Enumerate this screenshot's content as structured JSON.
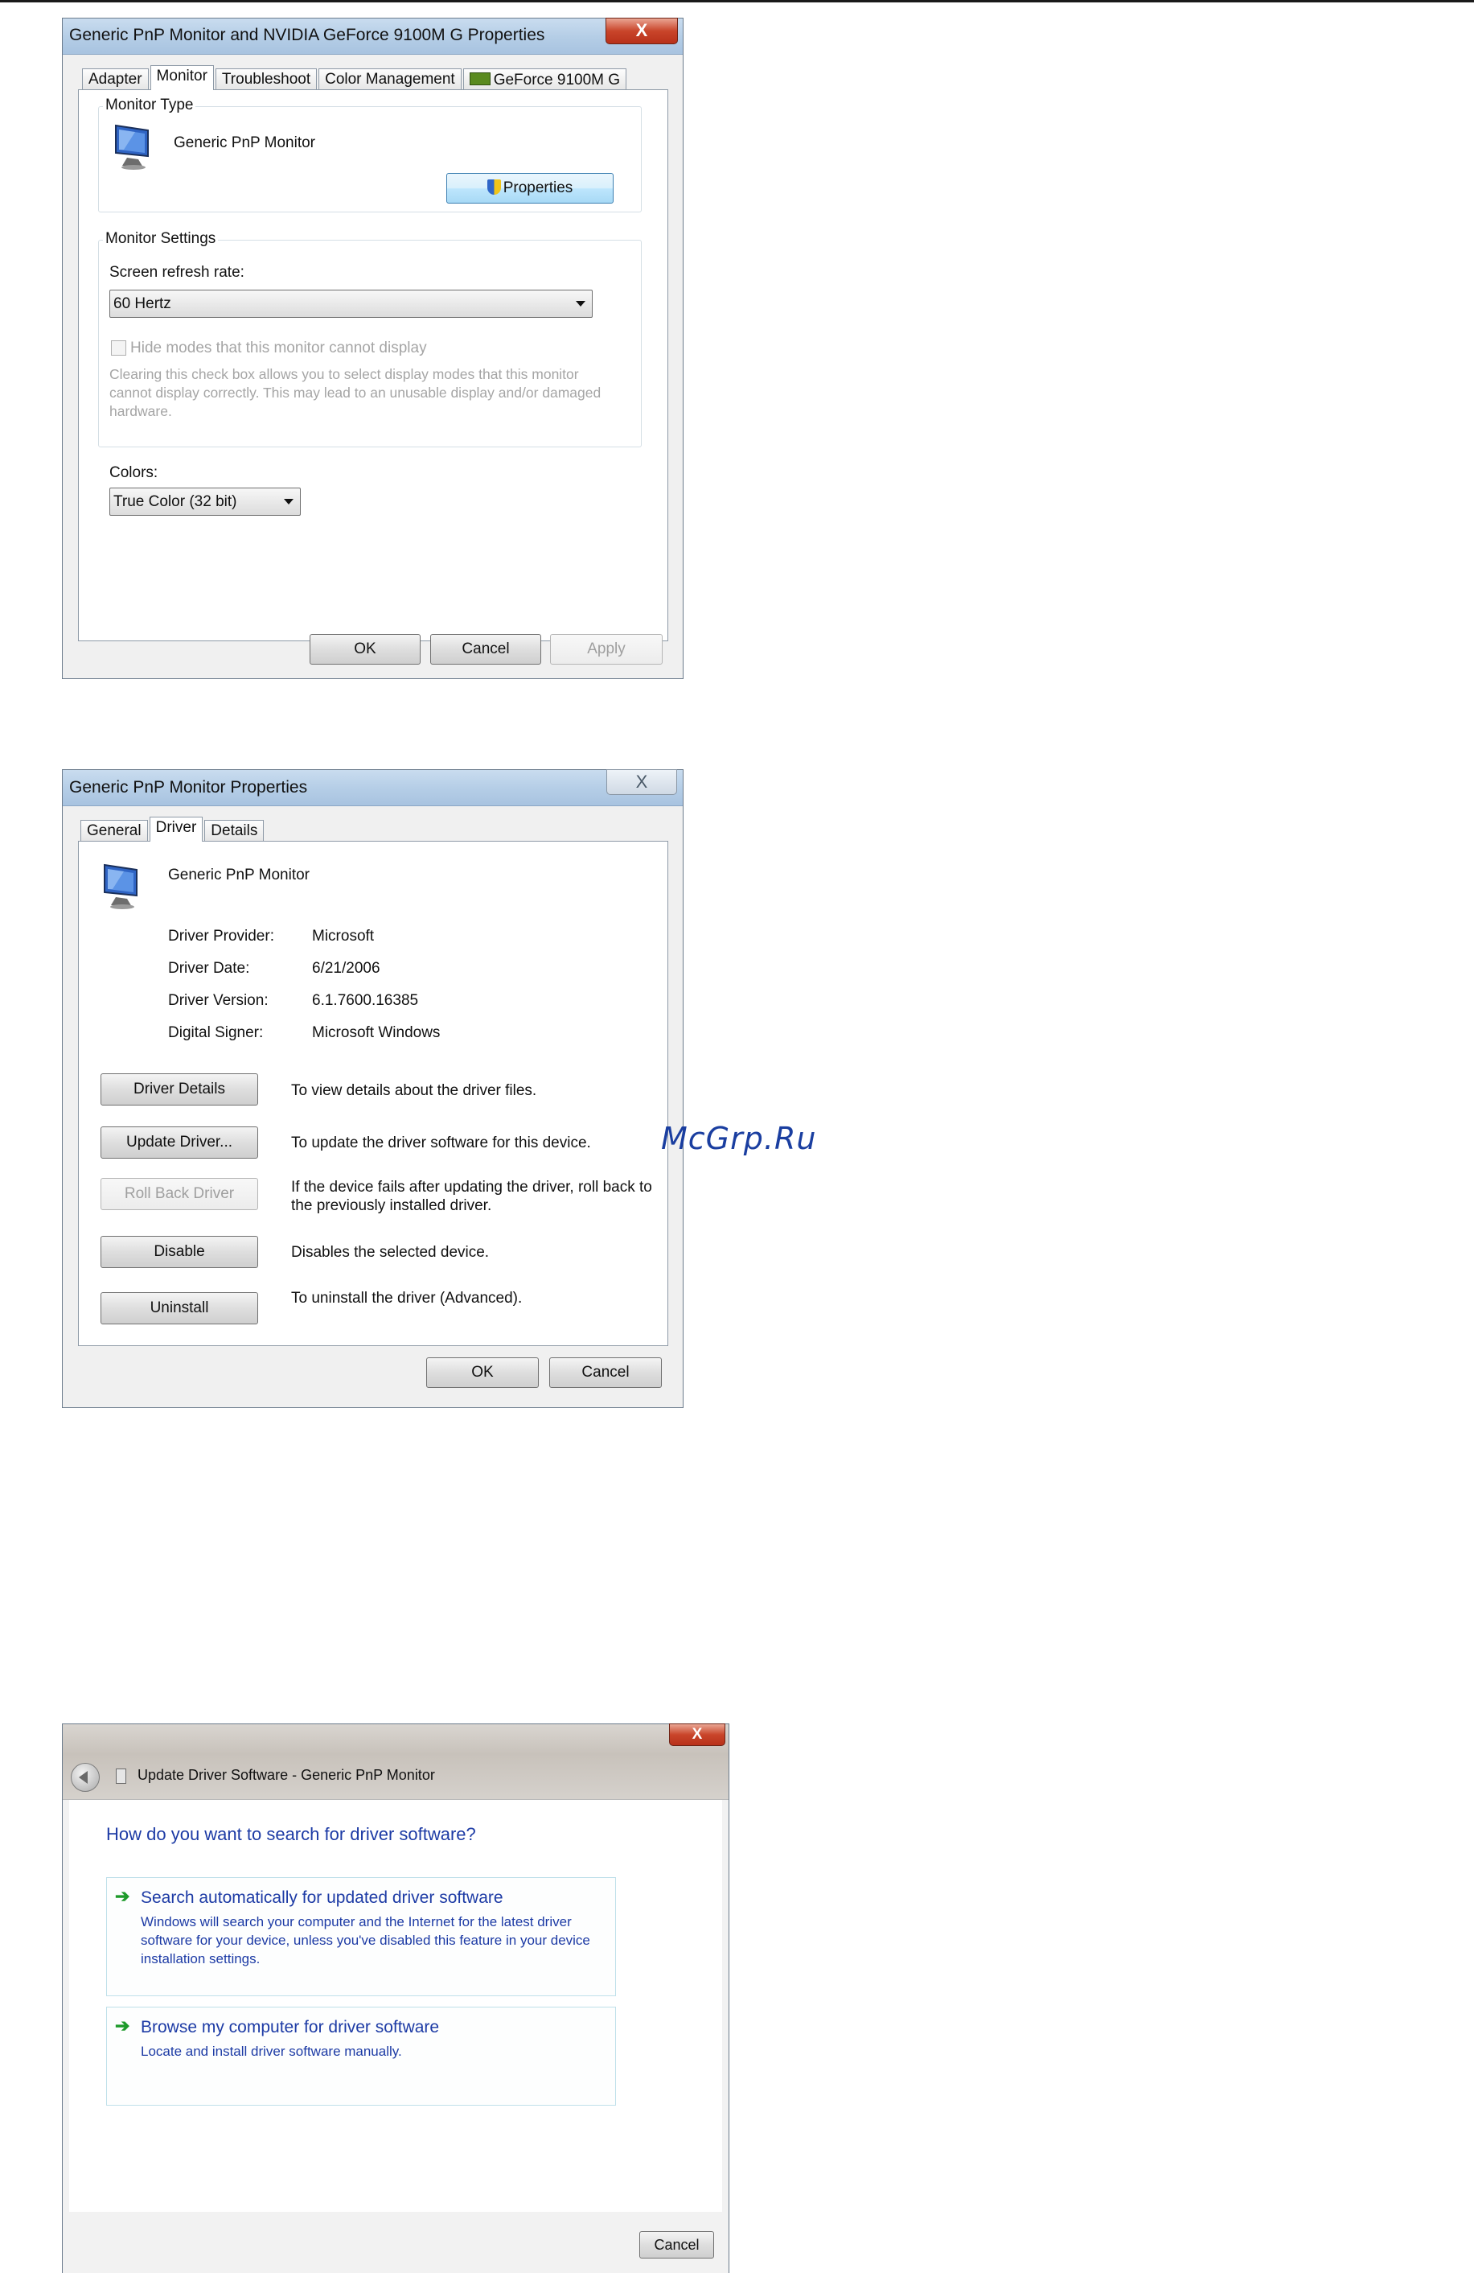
{
  "watermark": "McGrp.Ru",
  "dialog1": {
    "title": "Generic PnP Monitor and NVIDIA GeForce 9100M G   Properties",
    "close": "X",
    "tabs": [
      "Adapter",
      "Monitor",
      "Troubleshoot",
      "Color Management",
      "GeForce 9100M G"
    ],
    "active_tab": "Monitor",
    "monitor_type_legend": "Monitor Type",
    "monitor_name": "Generic PnP Monitor",
    "properties_button": "Properties",
    "monitor_settings_legend": "Monitor Settings",
    "refresh_label": "Screen refresh rate:",
    "refresh_value": "60 Hertz",
    "hide_modes_label": "Hide modes that this monitor cannot display",
    "hide_modes_checked": false,
    "hide_modes_note": "Clearing this check box allows you to select display modes that this monitor cannot display correctly. This may lead to an unusable display and/or damaged hardware.",
    "colors_label": "Colors:",
    "colors_value": "True Color (32 bit)",
    "ok": "OK",
    "cancel": "Cancel",
    "apply": "Apply"
  },
  "dialog2": {
    "title": "Generic PnP Monitor Properties",
    "close": "X",
    "tabs": [
      "General",
      "Driver",
      "Details"
    ],
    "active_tab": "Driver",
    "device_name": "Generic PnP Monitor",
    "info": [
      {
        "label": "Driver Provider:",
        "value": "Microsoft"
      },
      {
        "label": "Driver Date:",
        "value": "6/21/2006"
      },
      {
        "label": "Driver Version:",
        "value": "6.1.7600.16385"
      },
      {
        "label": "Digital Signer:",
        "value": "Microsoft Windows"
      }
    ],
    "actions": [
      {
        "button": "Driver Details",
        "desc": "To view details about the driver files.",
        "enabled": true
      },
      {
        "button": "Update Driver...",
        "desc": "To update the driver software for this device.",
        "enabled": true
      },
      {
        "button": "Roll Back Driver",
        "desc": "If the device fails after updating the driver, roll back to the previously installed driver.",
        "enabled": false
      },
      {
        "button": "Disable",
        "desc": "Disables the selected device.",
        "enabled": true
      },
      {
        "button": "Uninstall",
        "desc": "To uninstall the driver (Advanced).",
        "enabled": true
      }
    ],
    "ok": "OK",
    "cancel": "Cancel"
  },
  "dialog3": {
    "title": "Update Driver Software - Generic PnP Monitor",
    "close": "X",
    "heading": "How do you want to search for driver software?",
    "options": [
      {
        "title": "Search automatically for updated driver software",
        "desc": "Windows will search your computer and the Internet for the latest driver software for your device, unless you've disabled this feature in your device installation settings."
      },
      {
        "title": "Browse my computer for driver software",
        "desc": "Locate and install driver software manually."
      }
    ],
    "cancel": "Cancel"
  },
  "colors": {
    "link_blue": "#1d3ba5",
    "watermark_blue": "#1a3ea0",
    "close_red": "#c9452a",
    "arrow_green": "#1d9a2a"
  }
}
